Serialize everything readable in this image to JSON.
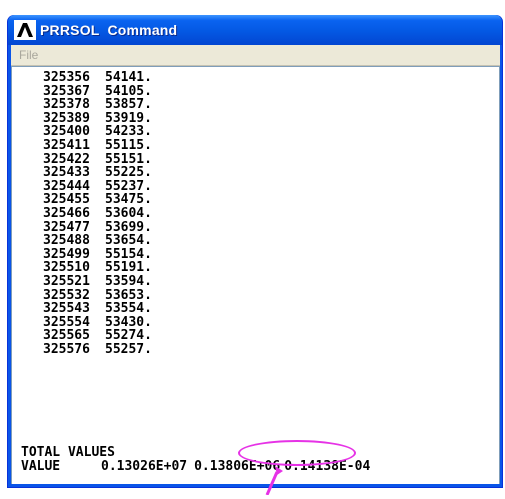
{
  "window": {
    "title": "PRRSOL  Command",
    "colors": {
      "title_bar": "#0458e3",
      "menu_bg": "#ece9d8",
      "highlight": "#e632e6"
    }
  },
  "menu": {
    "items": [
      {
        "label": "File"
      }
    ]
  },
  "console": {
    "rows": [
      {
        "node": "325356",
        "value": "54141."
      },
      {
        "node": "325367",
        "value": "54105."
      },
      {
        "node": "325378",
        "value": "53857."
      },
      {
        "node": "325389",
        "value": "53919."
      },
      {
        "node": "325400",
        "value": "54233."
      },
      {
        "node": "325411",
        "value": "55115."
      },
      {
        "node": "325422",
        "value": "55151."
      },
      {
        "node": "325433",
        "value": "55225."
      },
      {
        "node": "325444",
        "value": "55237."
      },
      {
        "node": "325455",
        "value": "53475."
      },
      {
        "node": "325466",
        "value": "53604."
      },
      {
        "node": "325477",
        "value": "53699."
      },
      {
        "node": "325488",
        "value": "53654."
      },
      {
        "node": "325499",
        "value": "55154."
      },
      {
        "node": "325510",
        "value": "55191."
      },
      {
        "node": "325521",
        "value": "53594."
      },
      {
        "node": "325532",
        "value": "53653."
      },
      {
        "node": "325543",
        "value": "53554."
      },
      {
        "node": "325554",
        "value": "53430."
      },
      {
        "node": "325565",
        "value": "55274."
      },
      {
        "node": "325576",
        "value": "55257."
      }
    ],
    "total_label": "TOTAL VALUES",
    "value_label": "VALUE",
    "totals": [
      "0.13026E+07",
      "0.13806E+06",
      "0.14138E-04"
    ]
  },
  "icons": {
    "app_logo": "ansys-logo-icon",
    "arrow": "arrow-up-icon"
  }
}
